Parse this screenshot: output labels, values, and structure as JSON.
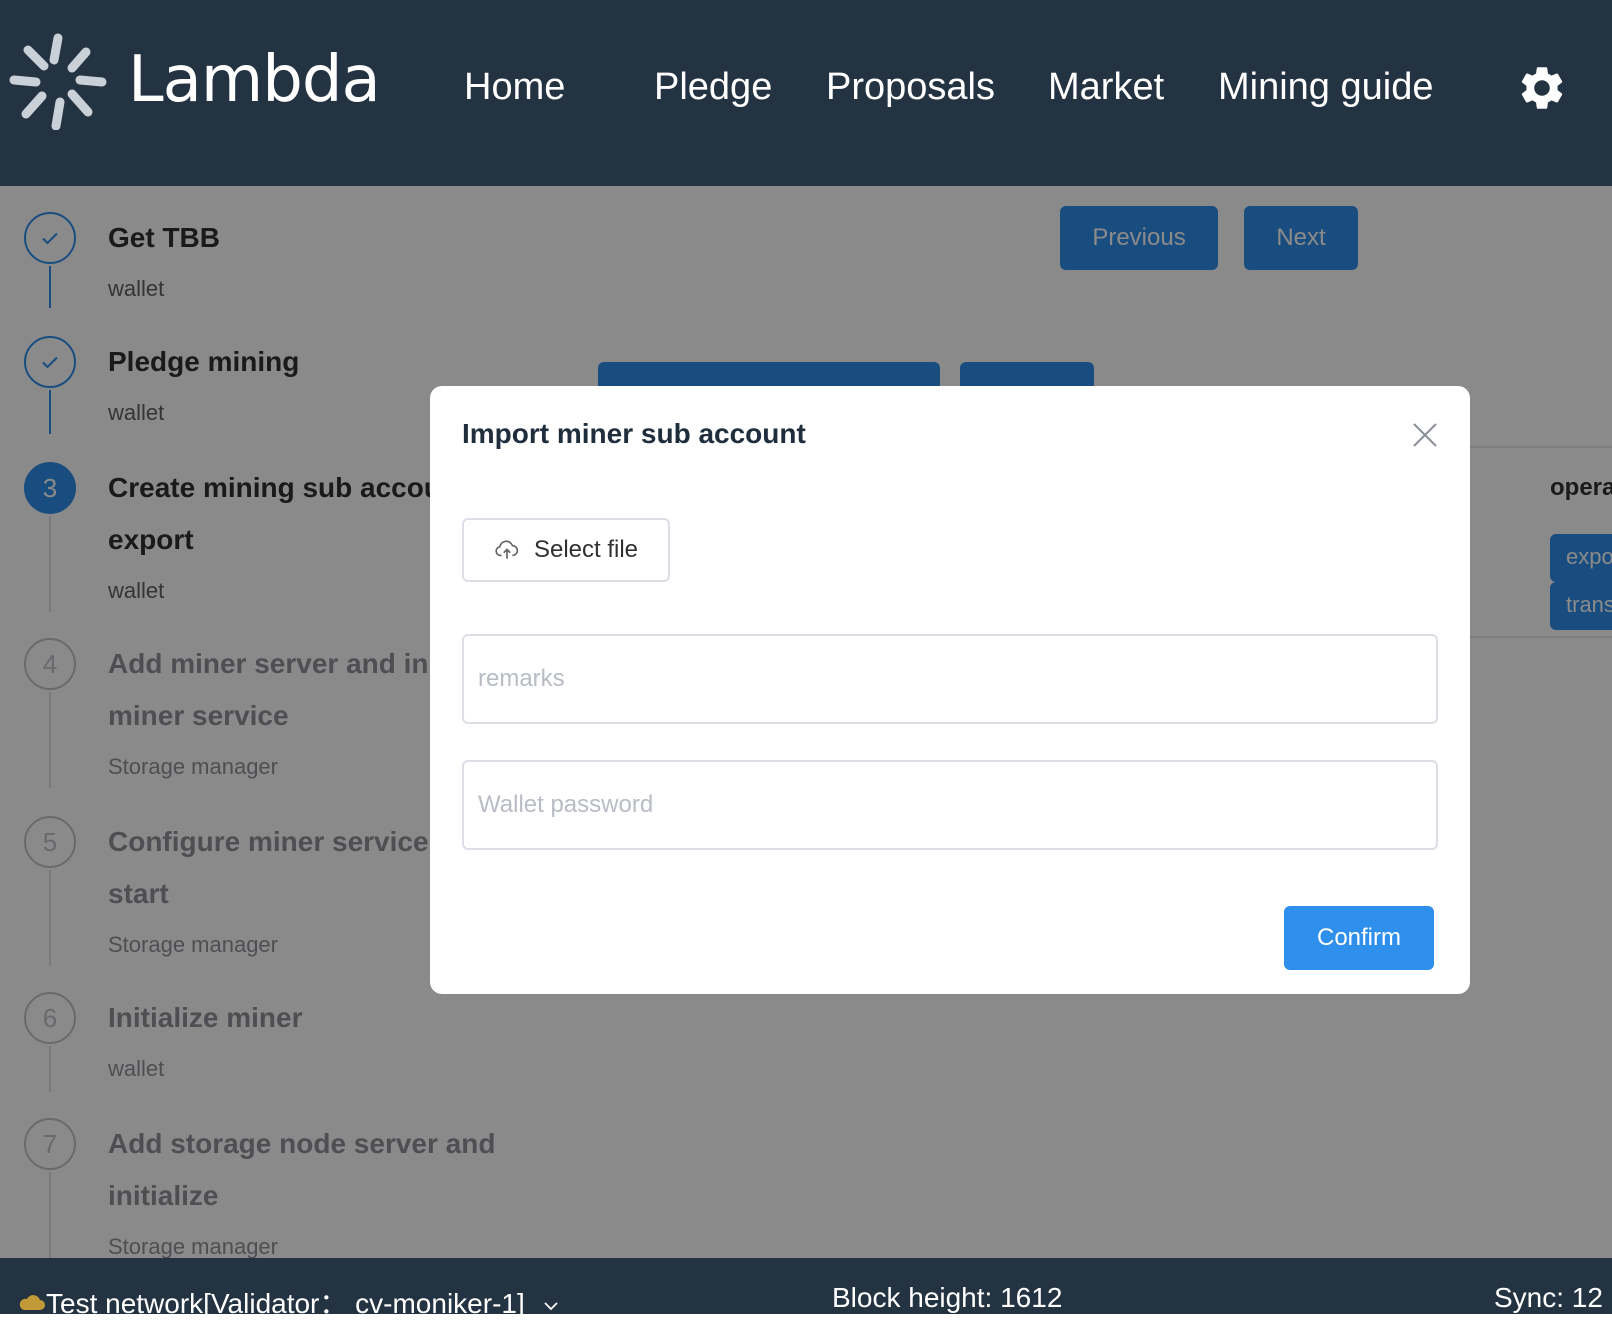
{
  "header": {
    "logo_text": "Lambda",
    "nav": [
      "Home",
      "Pledge",
      "Proposals",
      "Market",
      "Mining guide"
    ]
  },
  "steps": [
    {
      "title": "Get TBB",
      "sub": "wallet",
      "status": "done"
    },
    {
      "title": "Pledge mining",
      "sub": "wallet",
      "status": "done"
    },
    {
      "number": "3",
      "title_line1": "Create mining sub accou",
      "title_line2": "export",
      "sub": "wallet",
      "status": "active"
    },
    {
      "number": "4",
      "title_line1": "Add miner server and ini",
      "title_line2": "miner service",
      "sub": "Storage manager",
      "status": "pending"
    },
    {
      "number": "5",
      "title_line1": "Configure miner service",
      "title_line2": "start",
      "sub": "Storage manager",
      "status": "pending"
    },
    {
      "number": "6",
      "title": "Initialize miner",
      "sub": "wallet",
      "status": "pending"
    },
    {
      "number": "7",
      "title_line1": "Add storage node server and",
      "title_line2": "initialize",
      "sub": "Storage manager",
      "status": "pending"
    }
  ],
  "page_buttons": {
    "previous": "Previous",
    "next": "Next"
  },
  "table": {
    "operation_header": "opera",
    "actions": [
      "expo",
      "trans"
    ]
  },
  "dialog": {
    "title": "Import miner sub account",
    "select_file": "Select file",
    "remarks_placeholder": "remarks",
    "password_placeholder": "Wallet password",
    "confirm": "Confirm"
  },
  "footer": {
    "network": "Test network[Validator：  cv-moniker-1]",
    "block_height": "Block height: 1612",
    "sync": "Sync: 12"
  },
  "colors": {
    "header_bg": "#243342",
    "primary": "#2f8fec"
  }
}
